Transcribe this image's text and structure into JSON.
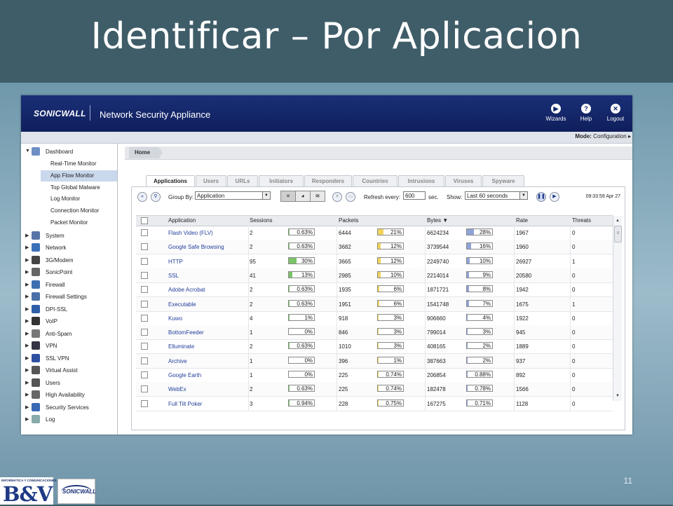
{
  "slide": {
    "title": "Identificar – Por Aplicacion",
    "page_number": "11"
  },
  "header": {
    "brand": "SONICWALL",
    "product": "Network Security Appliance",
    "buttons": [
      {
        "label": "Wizards",
        "icon": "wizard-icon"
      },
      {
        "label": "Help",
        "icon": "help-icon"
      },
      {
        "label": "Logout",
        "icon": "logout-icon"
      }
    ]
  },
  "mode": {
    "label": "Mode:",
    "value": "Configuration ▸"
  },
  "breadcrumb": "Home",
  "sidebar": {
    "dashboard": "Dashboard",
    "dashboard_items": [
      "Real-Time Monitor",
      "App Flow Monitor",
      "Top Global Malware",
      "Log Monitor",
      "Connection Monitor",
      "Packet Monitor"
    ],
    "sections": [
      "System",
      "Network",
      "3G/Modem",
      "SonicPoint",
      "Firewall",
      "Firewall Settings",
      "DPI-SSL",
      "VoIP",
      "Anti-Spam",
      "VPN",
      "SSL VPN",
      "Virtual Assist",
      "Users",
      "High Availability",
      "Security Services",
      "Log"
    ]
  },
  "tabs": [
    "Applications",
    "Users",
    "URLs",
    "Initiators",
    "Responders",
    "Countries",
    "Intrusions",
    "Viruses",
    "Spyware"
  ],
  "toolbar": {
    "group_by_label": "Group By:",
    "group_by_value": "Application",
    "refresh_label": "Refresh every:",
    "refresh_value": "600",
    "refresh_unit": "sec.",
    "show_label": "Show:",
    "show_value": "Last 60 seconds",
    "timestamp": "09:33:59 Apr 27"
  },
  "table": {
    "columns": [
      "Application",
      "Sessions",
      "Packets",
      "Bytes ▼",
      "Rate",
      "Threats"
    ],
    "rows": [
      {
        "app": "Flash Video (FLV)",
        "sessions": "2",
        "sess_pct": "0.63%",
        "packets": "6444",
        "pkt_pct": "21%",
        "bytes": "6624234",
        "byte_pct": "28%",
        "rate": "1967",
        "threats": "0"
      },
      {
        "app": "Google Safe Browsing",
        "sessions": "2",
        "sess_pct": "0.63%",
        "packets": "3682",
        "pkt_pct": "12%",
        "bytes": "3739544",
        "byte_pct": "16%",
        "rate": "1960",
        "threats": "0"
      },
      {
        "app": "HTTP",
        "sessions": "95",
        "sess_pct": "30%",
        "packets": "3665",
        "pkt_pct": "12%",
        "bytes": "2249740",
        "byte_pct": "10%",
        "rate": "26927",
        "threats": "1"
      },
      {
        "app": "SSL",
        "sessions": "41",
        "sess_pct": "13%",
        "packets": "2985",
        "pkt_pct": "10%",
        "bytes": "2214014",
        "byte_pct": "9%",
        "rate": "20580",
        "threats": "0"
      },
      {
        "app": "Adobe Acrobat",
        "sessions": "2",
        "sess_pct": "0.63%",
        "packets": "1935",
        "pkt_pct": "6%",
        "bytes": "1871721",
        "byte_pct": "8%",
        "rate": "1942",
        "threats": "0"
      },
      {
        "app": "Executable",
        "sessions": "2",
        "sess_pct": "0.63%",
        "packets": "1951",
        "pkt_pct": "6%",
        "bytes": "1541748",
        "byte_pct": "7%",
        "rate": "1675",
        "threats": "1"
      },
      {
        "app": "Kuwo",
        "sessions": "4",
        "sess_pct": "1%",
        "packets": "918",
        "pkt_pct": "3%",
        "bytes": "906660",
        "byte_pct": "4%",
        "rate": "1922",
        "threats": "0"
      },
      {
        "app": "BottomFeeder",
        "sessions": "1",
        "sess_pct": "0%",
        "packets": "846",
        "pkt_pct": "3%",
        "bytes": "799014",
        "byte_pct": "3%",
        "rate": "945",
        "threats": "0"
      },
      {
        "app": "Elluminate",
        "sessions": "2",
        "sess_pct": "0.63%",
        "packets": "1010",
        "pkt_pct": "3%",
        "bytes": "408165",
        "byte_pct": "2%",
        "rate": "1889",
        "threats": "0"
      },
      {
        "app": "Archive",
        "sessions": "1",
        "sess_pct": "0%",
        "packets": "396",
        "pkt_pct": "1%",
        "bytes": "387663",
        "byte_pct": "2%",
        "rate": "937",
        "threats": "0"
      },
      {
        "app": "Google Earth",
        "sessions": "1",
        "sess_pct": "0%",
        "packets": "225",
        "pkt_pct": "0.74%",
        "bytes": "206854",
        "byte_pct": "0.88%",
        "rate": "892",
        "threats": "0"
      },
      {
        "app": "WebEx",
        "sessions": "2",
        "sess_pct": "0.63%",
        "packets": "225",
        "pkt_pct": "0.74%",
        "bytes": "182478",
        "byte_pct": "0.78%",
        "rate": "1566",
        "threats": "0"
      },
      {
        "app": "Full Tilt Poker",
        "sessions": "3",
        "sess_pct": "0.94%",
        "packets": "228",
        "pkt_pct": "0.75%",
        "bytes": "167275",
        "byte_pct": "0.71%",
        "rate": "1128",
        "threats": "0"
      }
    ]
  },
  "footer_logos": {
    "bv_tagline": "INFORMÁTICA Y COMUNICACIONES",
    "bv_name": "B&V",
    "sonicwall": "SONICWALL"
  },
  "colors": {
    "sessions_bar": "#7cc46a",
    "packets_bar": "#f0d35a",
    "bytes_bar": "#8fa3d6"
  }
}
